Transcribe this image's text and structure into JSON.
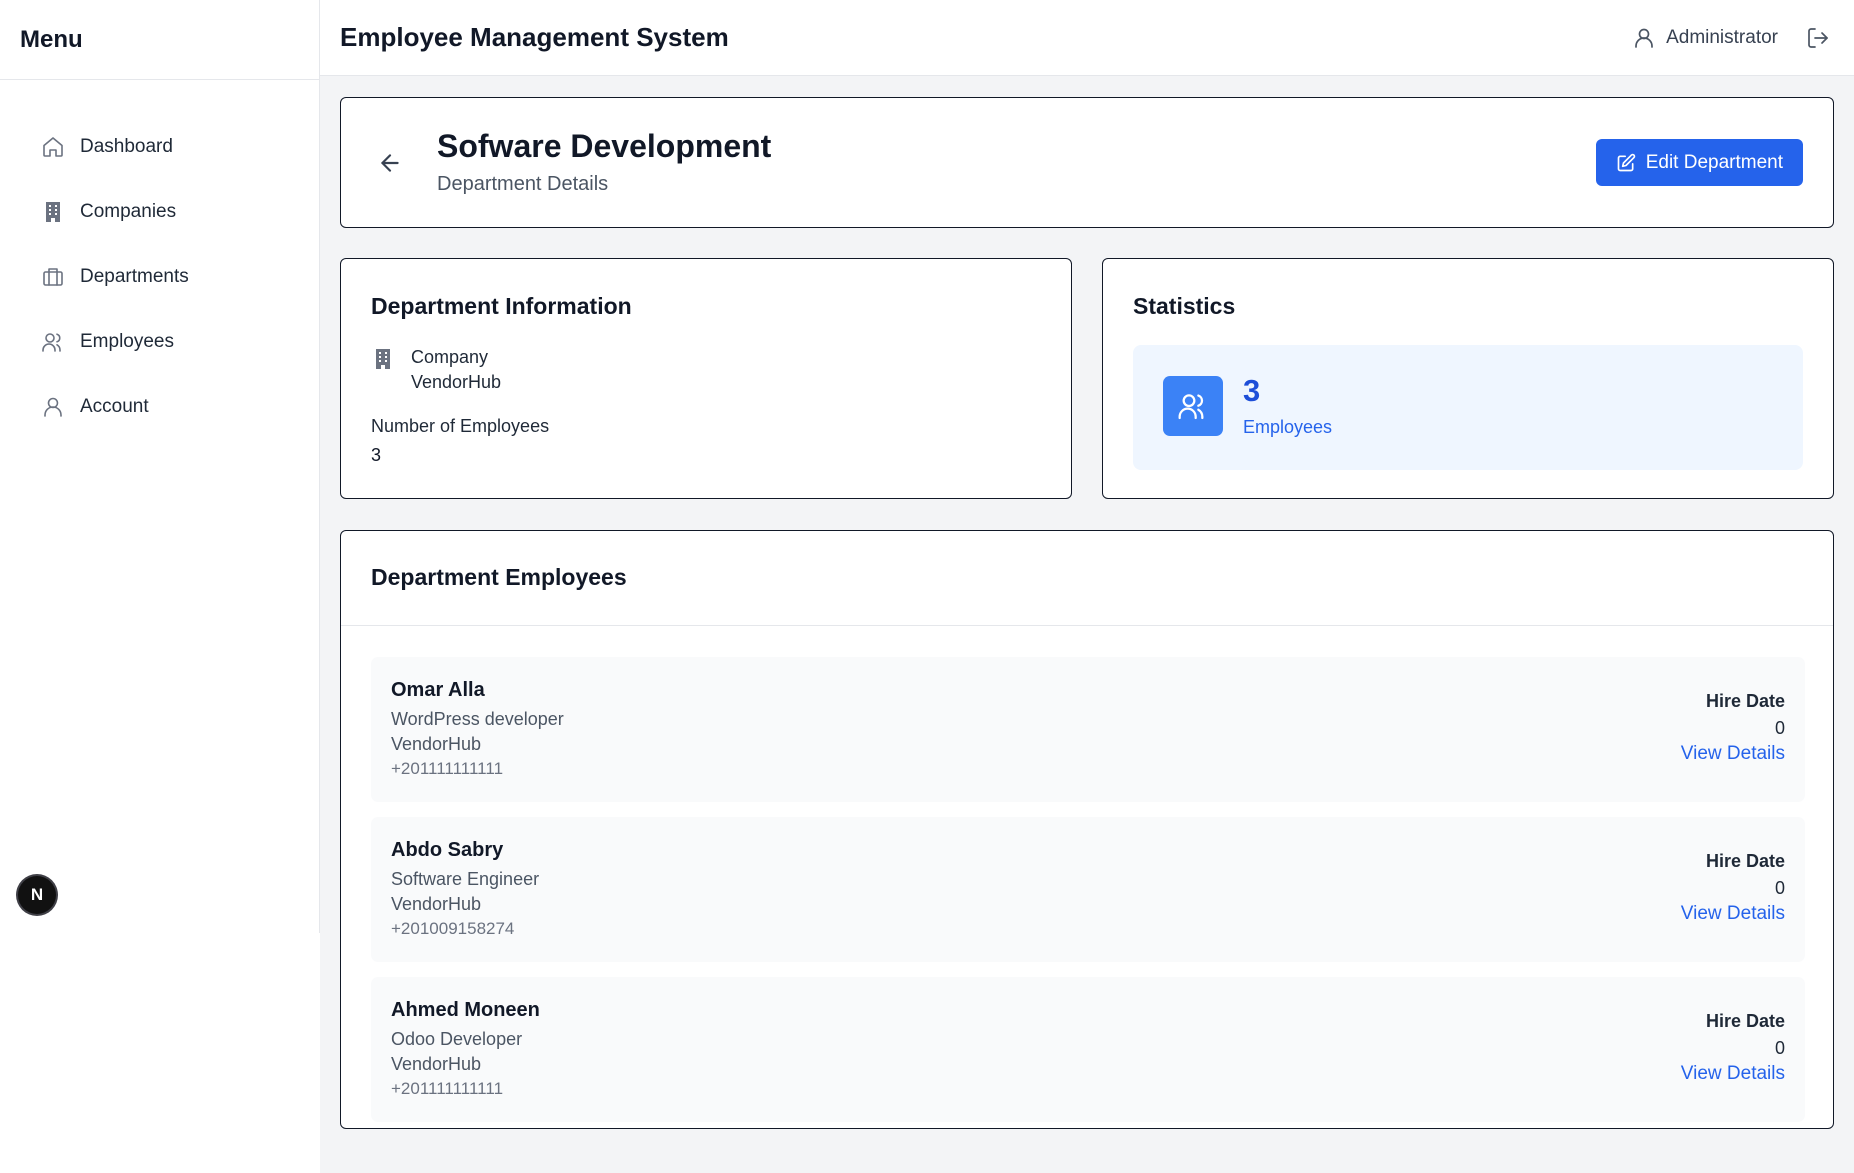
{
  "sidebar": {
    "title": "Menu",
    "items": [
      {
        "label": "Dashboard",
        "icon": "home-icon"
      },
      {
        "label": "Companies",
        "icon": "building-icon"
      },
      {
        "label": "Departments",
        "icon": "briefcase-icon"
      },
      {
        "label": "Employees",
        "icon": "users-icon"
      },
      {
        "label": "Account",
        "icon": "user-icon"
      }
    ],
    "badge": "N"
  },
  "topbar": {
    "title": "Employee Management System",
    "user": "Administrator"
  },
  "header": {
    "title": "Sofware Development",
    "subtitle": "Department Details",
    "edit_label": "Edit Department"
  },
  "info": {
    "title": "Department Information",
    "company_label": "Company",
    "company_value": "VendorHub",
    "employees_label": "Number of Employees",
    "employees_value": "3"
  },
  "stats": {
    "title": "Statistics",
    "count": "3",
    "label": "Employees"
  },
  "employees": {
    "title": "Department Employees",
    "hire_label": "Hire Date",
    "view_label": "View Details",
    "items": [
      {
        "name": "Omar Alla",
        "role": "WordPress developer",
        "company": "VendorHub",
        "phone": "+201111111111",
        "hire": "0"
      },
      {
        "name": "Abdo Sabry",
        "role": "Software Engineer",
        "company": "VendorHub",
        "phone": "+201009158274",
        "hire": "0"
      },
      {
        "name": "Ahmed Moneen",
        "role": "Odoo Developer",
        "company": "VendorHub",
        "phone": "+201111111111",
        "hire": "0"
      }
    ]
  },
  "colors": {
    "accent": "#2563eb",
    "stat_bg": "#eff6ff",
    "page_bg": "#f3f4f6"
  }
}
